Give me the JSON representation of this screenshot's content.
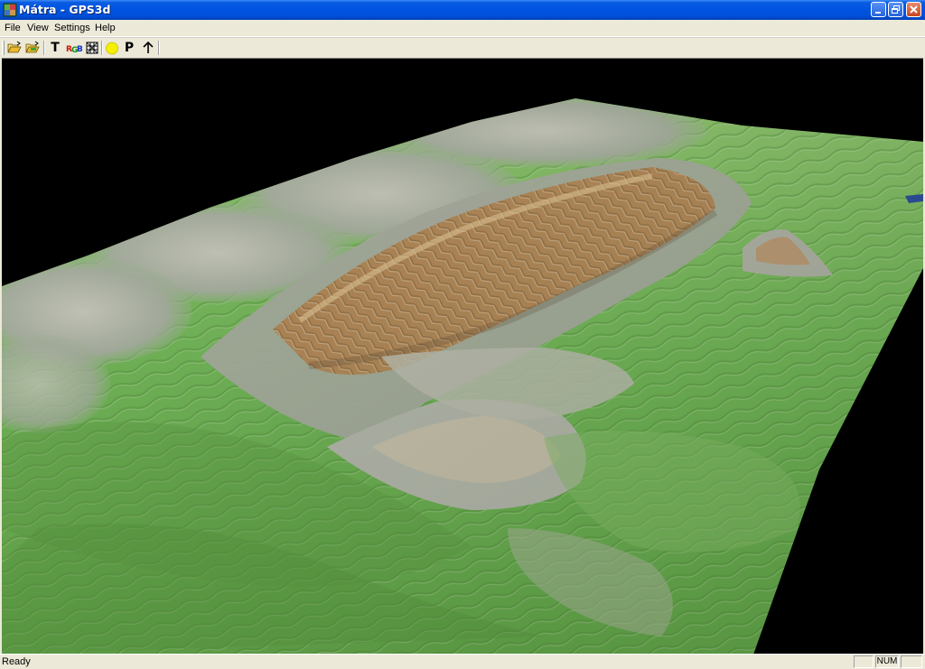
{
  "window": {
    "title": "Mátra - GPS3d",
    "app_icon": "map-app-icon",
    "controls": [
      "minimize-icon",
      "restore-icon",
      "close-icon"
    ],
    "colors": {
      "titlebar": "#0054e3",
      "close": "#c8451e",
      "chrome": "#ece9d8"
    }
  },
  "menu": {
    "items": [
      "File",
      "View",
      "Settings",
      "Help"
    ]
  },
  "toolbar": {
    "tools": [
      {
        "name": "open-file",
        "icon": "folder-open-icon"
      },
      {
        "name": "open-track",
        "icon": "folder-open-green-icon"
      },
      {
        "name": "texture",
        "icon": "text-t-icon",
        "label": "T"
      },
      {
        "name": "rgb-color",
        "icon": "rgb-icon",
        "label": "RGB"
      },
      {
        "name": "grid",
        "icon": "grid-icon"
      },
      {
        "name": "sun-light",
        "icon": "sun-icon"
      },
      {
        "name": "points",
        "icon": "letter-p-icon",
        "label": "P"
      },
      {
        "name": "north-arrow",
        "icon": "arrow-up-icon"
      }
    ]
  },
  "viewport": {
    "content": "3d-terrain-render",
    "colors": {
      "background": "#000000",
      "lowland": "#6fb552",
      "slope": "#b7bab0",
      "ridge": "#b88c58"
    }
  },
  "status": {
    "text": "Ready",
    "indicators": [
      "",
      "NUM",
      ""
    ]
  }
}
